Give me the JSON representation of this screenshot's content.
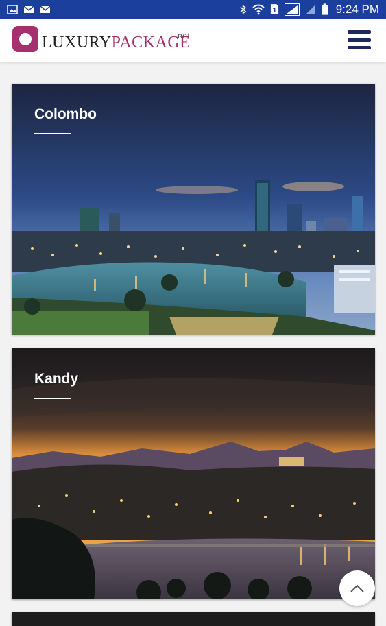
{
  "status_bar": {
    "time": "9:24 PM",
    "left_icons": [
      "gallery-icon",
      "mail-icon",
      "mail-icon"
    ],
    "right_icons": [
      "bluetooth-icon",
      "wifi-icon",
      "sim-1-icon",
      "signal-icon",
      "signal-icon",
      "battery-icon"
    ]
  },
  "header": {
    "logo_part1": "LUXURY",
    "logo_part2": "PACKAGE",
    "logo_tld": ".net",
    "brand_color": "#a6306d",
    "menu_icon": "hamburger-menu-icon"
  },
  "destinations": [
    {
      "title": "Colombo"
    },
    {
      "title": "Kandy"
    }
  ],
  "scroll_top_icon": "chevron-up-icon"
}
